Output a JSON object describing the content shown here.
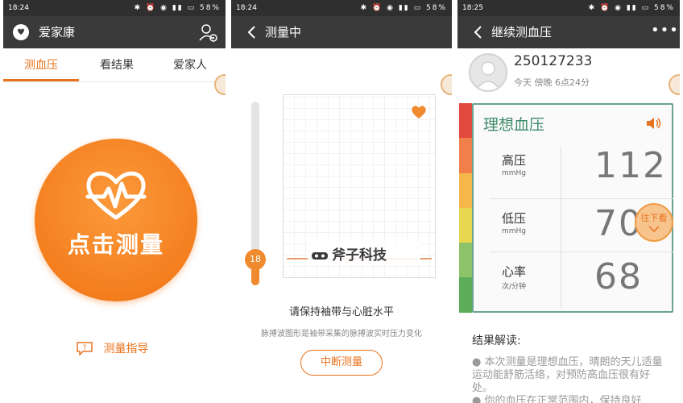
{
  "colors": {
    "accent": "#e8731e",
    "ideal_green": "#3e8b6c",
    "appbar": "#3a3a3a"
  },
  "screen1": {
    "status_time": "18:24",
    "status_icons": "✱ ⏰ ◉ ▮▮ ▭ 58%",
    "app_title": "爱家康",
    "tabs": [
      {
        "label": "测血压"
      },
      {
        "label": "看结果"
      },
      {
        "label": "爱家人"
      }
    ],
    "measure_button_label": "点击测量",
    "guide_label": "测量指导"
  },
  "screen2": {
    "status_time": "18:24",
    "status_icons": "✱ ⏰ ◉ ▮▮ ▭ 58%",
    "title": "测量中",
    "pressure_value": "18",
    "pressure_fraction": 0.08,
    "watermark": "斧子科技",
    "instruction": "请保持袖带与心脏水平",
    "note": "脉搏波图形是袖带采集的脉搏波实时压力变化",
    "stop_button_label": "中断测量"
  },
  "screen3": {
    "status_time": "18:25",
    "status_icons": "✱ ⏰ ◉ ▮▮ ▭ 58%",
    "title": "继续测血压",
    "more": "•••",
    "user_id": "250127233",
    "time": "今天  傍晚 6点24分",
    "result_label": "理想血压",
    "rows": [
      {
        "name": "高压",
        "unit": "mmHg",
        "value": "112"
      },
      {
        "name": "低压",
        "unit": "mmHg",
        "value": "70"
      },
      {
        "name": "心率",
        "unit": "次/分钟",
        "value": "68"
      }
    ],
    "scroll_down_label": "往下看",
    "interpretation_title": "结果解读:",
    "interpretation_text": "● 本次测量是理想血压，晴朗的天儿适量运动能舒筋活络，对预防高血压很有好处。",
    "interpretation_text2": "● 你的血压在正常范围内，保持良好"
  }
}
